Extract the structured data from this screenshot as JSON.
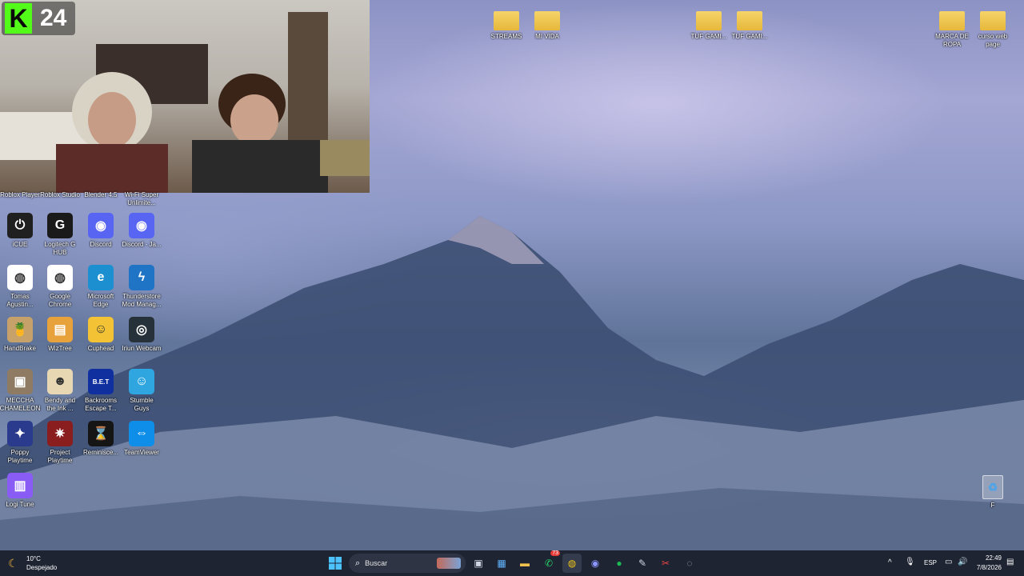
{
  "webcam": {
    "kick_logo": "K",
    "viewer_count": "24"
  },
  "desktop_icons_left": [
    {
      "label": "iCUE",
      "color": "#202020",
      "glyph": "⏻"
    },
    {
      "label": "Logitech G HUB",
      "color": "#1a1a1a",
      "glyph": "G"
    },
    {
      "label": "Discord",
      "color": "#5865f2",
      "glyph": "◉"
    },
    {
      "label": "Discord - Ja...",
      "color": "#5865f2",
      "glyph": "◉"
    },
    {
      "label": "Tomas Agustin...",
      "color": "#ffffff",
      "glyph": "◍"
    },
    {
      "label": "Google Chrome",
      "color": "#ffffff",
      "glyph": "◍"
    },
    {
      "label": "Microsoft Edge",
      "color": "#1c8fd1",
      "glyph": "e"
    },
    {
      "label": "Thunderstore Mod Manag...",
      "color": "#1f74c5",
      "glyph": "ϟ"
    },
    {
      "label": "HandBrake",
      "color": "#c6a26a",
      "glyph": "🍍"
    },
    {
      "label": "WizTree",
      "color": "#e8a23c",
      "glyph": "▤"
    },
    {
      "label": "Cuphead",
      "color": "#f3c335",
      "glyph": "☺"
    },
    {
      "label": "Iriun Webcam",
      "color": "#27313a",
      "glyph": "◎"
    },
    {
      "label": "MECCHA CHAMELEON",
      "color": "#8f7b63",
      "glyph": "▣"
    },
    {
      "label": "Bendy and the Ink ...",
      "color": "#e8d7b3",
      "glyph": "☻"
    },
    {
      "label": "Backrooms Escape T...",
      "color": "#1030a0",
      "glyph": "B.E.T"
    },
    {
      "label": "Stumble Guys",
      "color": "#2fa6e0",
      "glyph": "☺"
    },
    {
      "label": "Poppy Playtime",
      "color": "#2a3a8c",
      "glyph": "✦"
    },
    {
      "label": "Project Playtime",
      "color": "#8a1d1d",
      "glyph": "✷"
    },
    {
      "label": "Reminisce...",
      "color": "#151515",
      "glyph": "⌛"
    },
    {
      "label": "TeamViewer",
      "color": "#0e8ee9",
      "glyph": "⇔"
    },
    {
      "label": "Logi Tune",
      "color": "#8a5cf6",
      "glyph": "▥"
    }
  ],
  "partial_labels": [
    "Roblox Player",
    "Roblox Studio",
    "Blender 4.5",
    "Wi-Fi Super Unlimite..."
  ],
  "desktop_icons_top": [
    {
      "label": "STREAMS",
      "type": "folder"
    },
    {
      "label": "MI VIDA",
      "type": "folder"
    },
    {
      "label": "TUF GAMI...",
      "type": "folder"
    },
    {
      "label": "TUF GAMI...",
      "type": "folder"
    },
    {
      "label": "MARCA DE ROPA",
      "type": "folder"
    },
    {
      "label": "curso web page",
      "type": "folder"
    }
  ],
  "recycle_bin": {
    "label": "F"
  },
  "taskbar": {
    "weather_temp": "10°C",
    "weather_desc": "Despejado",
    "search_placeholder": "Buscar",
    "whatsapp_badge": "73",
    "language": "ESP",
    "time": "22:49",
    "date": "7/8/2026"
  }
}
